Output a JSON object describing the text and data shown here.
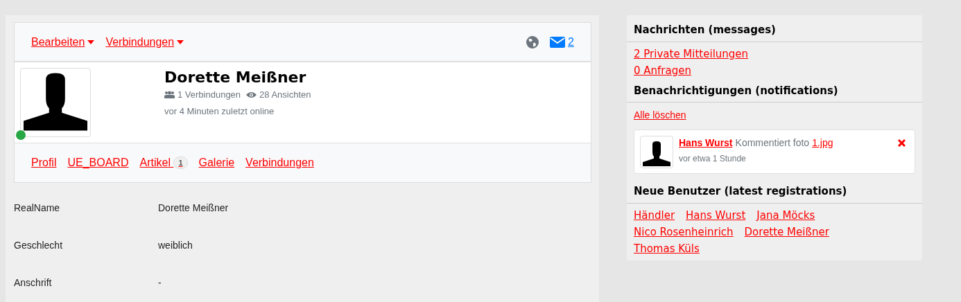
{
  "toolbar": {
    "menus": [
      {
        "label": "Bearbeiten"
      },
      {
        "label": "Verbindungen"
      }
    ],
    "message_count": "2"
  },
  "profile": {
    "name": "Dorette Meißner",
    "connections": "1 Verbindungen",
    "views": "28 Ansichten",
    "last_online": "vor 4 Minuten zuletzt online",
    "online": true
  },
  "tabs": [
    {
      "label": "Profil"
    },
    {
      "label": "UE_BOARD"
    },
    {
      "label": "Artikel ",
      "badge": "1"
    },
    {
      "label": "Galerie"
    },
    {
      "label": "Verbindungen"
    }
  ],
  "fields": [
    {
      "label": "RealName",
      "value": "Dorette Meißner"
    },
    {
      "label": "Geschlecht",
      "value": "weiblich"
    },
    {
      "label": "Anschrift",
      "value": "-"
    }
  ],
  "sidebar": {
    "messages": {
      "title": "Nachrichten (messages)",
      "links": [
        "2 Private Mitteilungen",
        "0 Anfragen"
      ]
    },
    "notifications": {
      "title": "Benachrichtigungen (notifications)",
      "clear_all": "Alle löschen",
      "items": [
        {
          "user": "Hans Wurst",
          "action": "Kommentiert foto",
          "target": "1.jpg",
          "time": "vor etwa 1 Stunde"
        }
      ]
    },
    "new_users": {
      "title": "Neue Benutzer (latest registrations)",
      "users": [
        "Händler",
        "Hans Wurst",
        "Jana Möcks",
        "Nico Rosenheinrich",
        "Dorette Meißner",
        "Thomas Küls"
      ]
    }
  }
}
